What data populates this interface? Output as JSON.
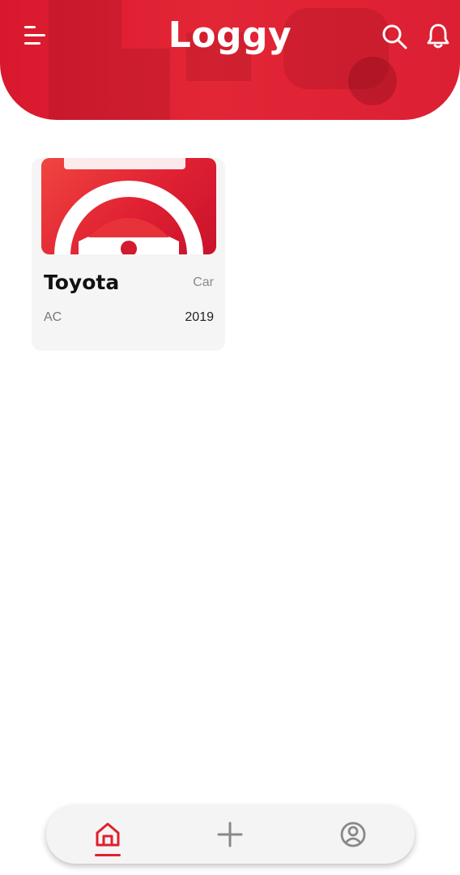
{
  "header": {
    "title": "Loggy",
    "menu_icon": "menu-icon",
    "search_icon": "search-icon",
    "notification_icon": "bell-icon",
    "background_color": "#e32636"
  },
  "cards": [
    {
      "name": "Toyota",
      "type": "Car",
      "model": "AC",
      "year": "2019",
      "image_icon": "steering-wheel-logo"
    }
  ],
  "bottom_nav": {
    "items": [
      {
        "icon": "home-icon",
        "active": true
      },
      {
        "icon": "plus-icon",
        "active": false
      },
      {
        "icon": "profile-icon",
        "active": false
      }
    ],
    "active_color": "#e0202f",
    "inactive_color": "#888888"
  }
}
